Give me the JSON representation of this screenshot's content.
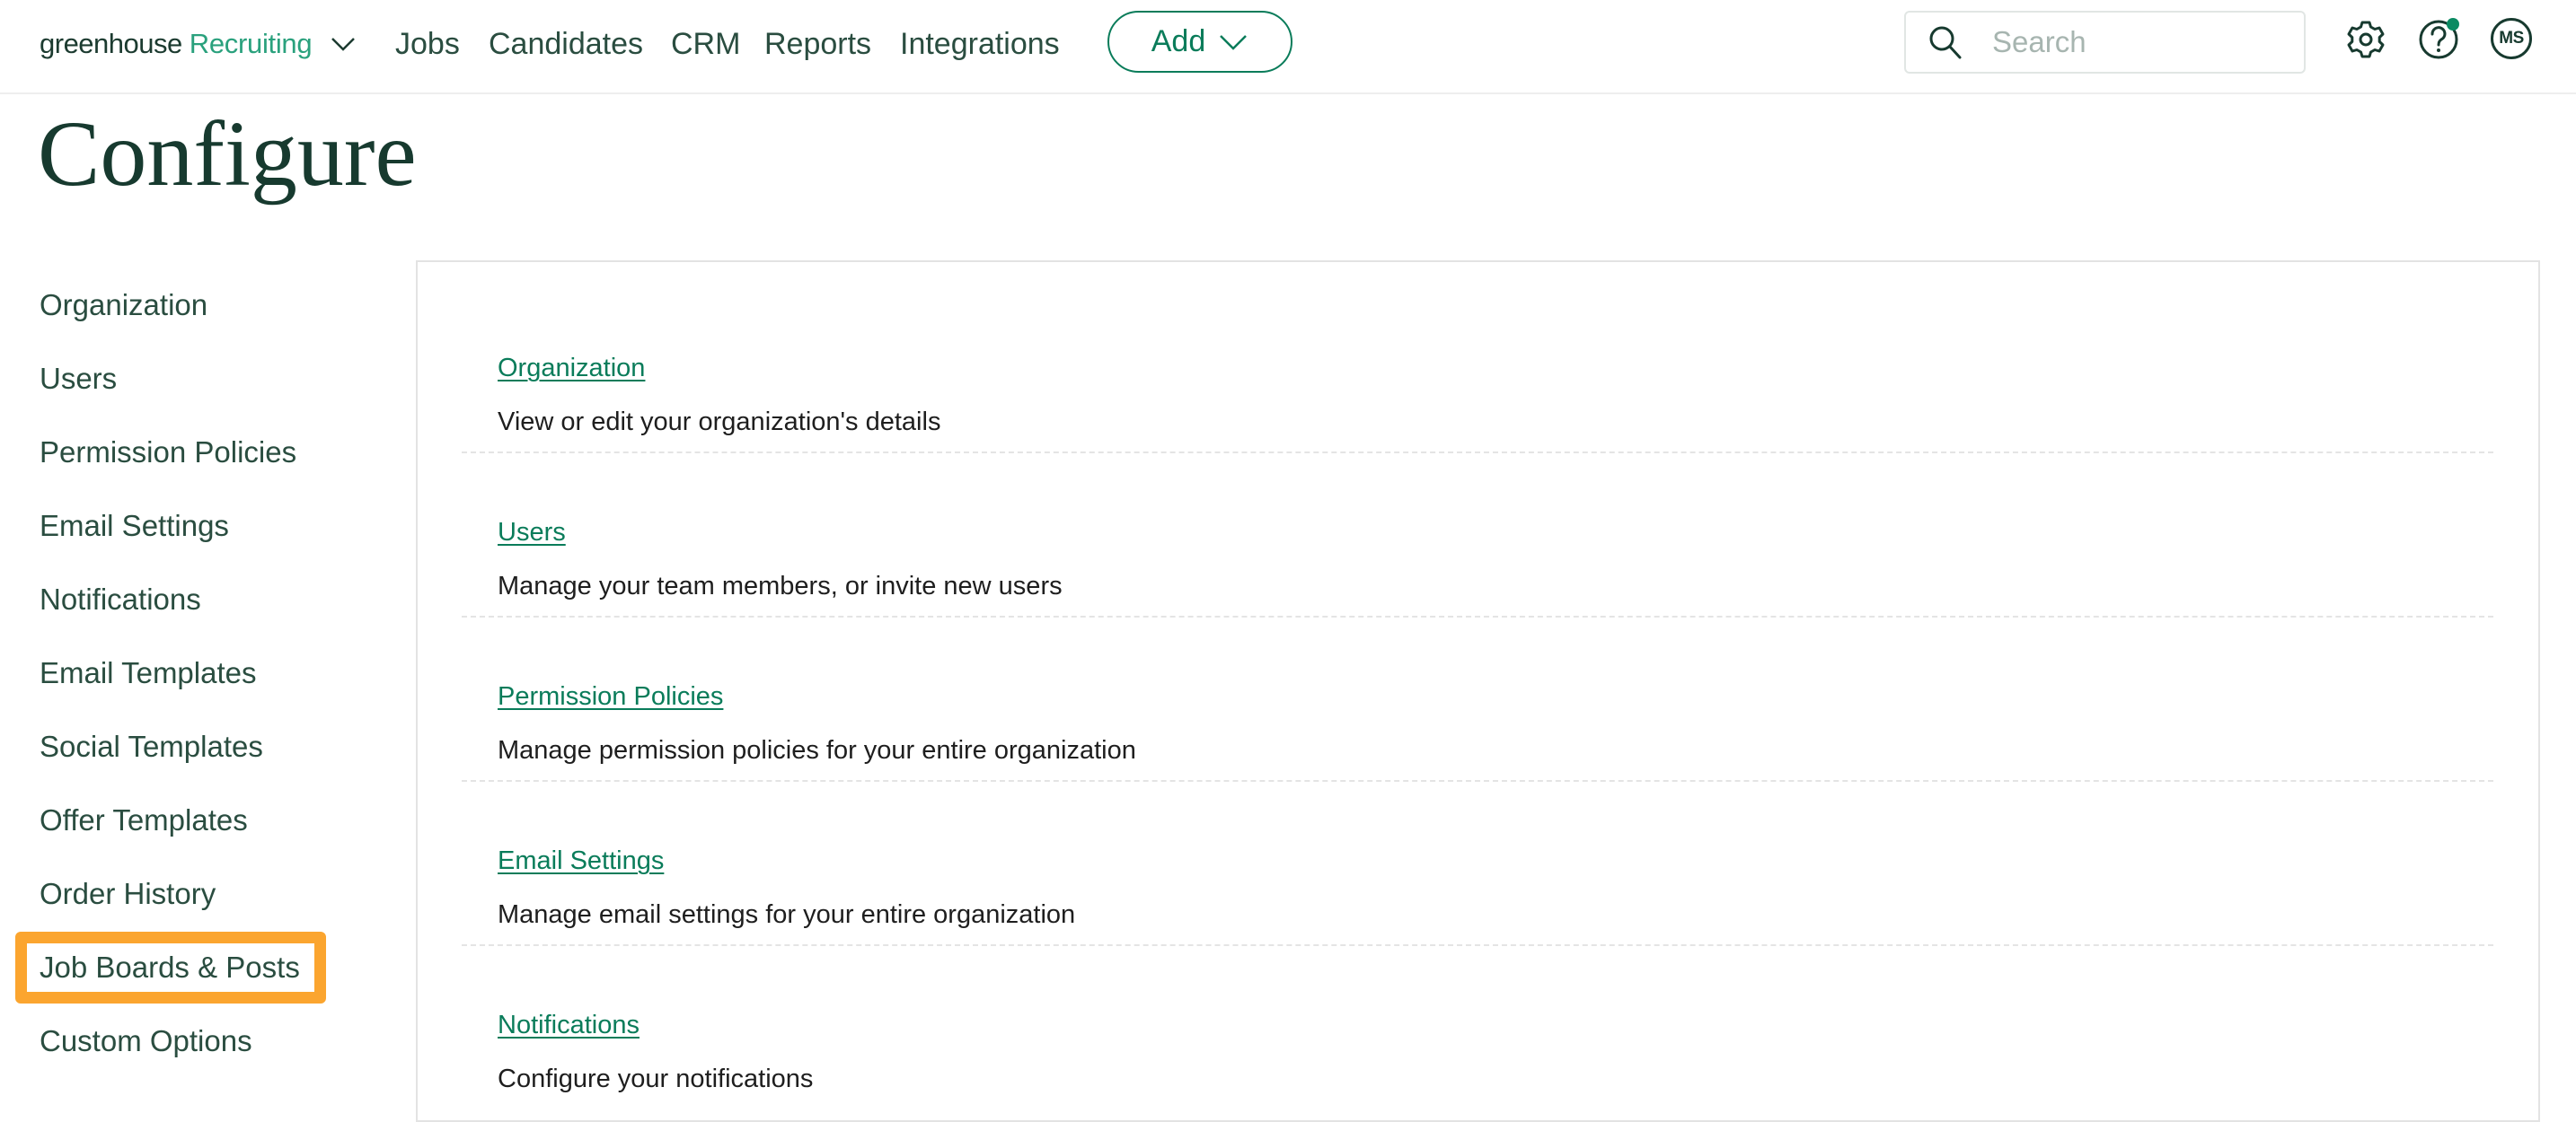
{
  "header": {
    "logo_main": "greenhouse",
    "logo_sub": "Recruiting",
    "nav": [
      {
        "label": "Jobs"
      },
      {
        "label": "Candidates"
      },
      {
        "label": "CRM"
      },
      {
        "label": "Reports"
      },
      {
        "label": "Integrations"
      }
    ],
    "add_label": "Add",
    "search": {
      "placeholder": "Search",
      "value": ""
    },
    "icons": {
      "settings": "gear-icon",
      "help": "help-icon",
      "search": "search-icon"
    },
    "help_has_notification": true,
    "avatar_initials": "MS"
  },
  "page": {
    "title": "Configure"
  },
  "sidebar": {
    "highlighted_index": 9,
    "items": [
      {
        "label": "Organization"
      },
      {
        "label": "Users"
      },
      {
        "label": "Permission Policies"
      },
      {
        "label": "Email Settings"
      },
      {
        "label": "Notifications"
      },
      {
        "label": "Email Templates"
      },
      {
        "label": "Social Templates"
      },
      {
        "label": "Offer Templates"
      },
      {
        "label": "Order History"
      },
      {
        "label": "Job Boards & Posts"
      },
      {
        "label": "Custom Options"
      }
    ]
  },
  "content": {
    "rows": [
      {
        "link": "Organization",
        "description": "View or edit your organization's details"
      },
      {
        "link": "Users",
        "description": "Manage your team members, or invite new users"
      },
      {
        "link": "Permission Policies",
        "description": "Manage permission policies for your entire organization"
      },
      {
        "link": "Email Settings",
        "description": "Manage email settings for your entire organization"
      },
      {
        "link": "Notifications",
        "description": "Configure your notifications"
      }
    ]
  },
  "colors": {
    "brand_green": "#0a7c5a",
    "logo_accent": "#2aa17d",
    "title_dark": "#173a2f",
    "nav_text": "#2a4d40",
    "highlight_orange": "#fba52f",
    "notification_dot": "#0a8a62"
  }
}
